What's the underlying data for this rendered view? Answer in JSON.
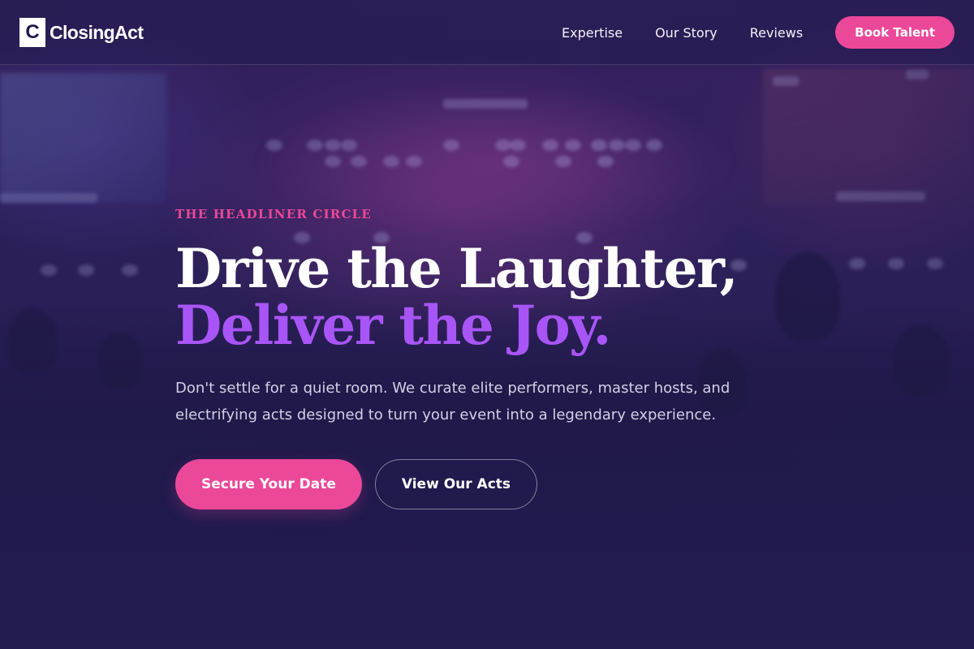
{
  "theme": {
    "background": "#221b50",
    "accent_pink": "#ec4899",
    "accent_purple": "#a855f7",
    "text_primary": "#ffffff",
    "text_muted": "#d3d0e6"
  },
  "header": {
    "logo_mark": "C",
    "logo_text": "ClosingAct",
    "nav": [
      {
        "label": "Expertise"
      },
      {
        "label": "Our Story"
      },
      {
        "label": "Reviews"
      }
    ],
    "cta_label": "Book Talent"
  },
  "hero": {
    "eyebrow": "THE HEADLINER CIRCLE",
    "headline_line1": "Drive the Laughter,",
    "headline_line2": "Deliver the Joy.",
    "subtitle": "Don't settle for a quiet room. We curate elite performers, master hosts, and electrifying acts designed to turn your event into a legendary experience.",
    "primary_button": "Secure Your Date",
    "secondary_button": "View Our Acts"
  }
}
